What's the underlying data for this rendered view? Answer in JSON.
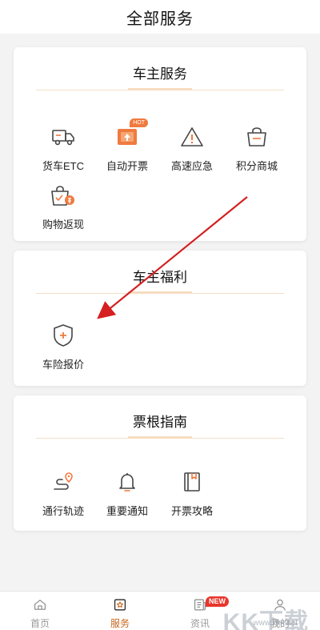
{
  "header": {
    "title": "全部服务"
  },
  "sections": [
    {
      "title": "车主服务",
      "items": [
        {
          "label": "货车ETC",
          "icon": "truck-icon"
        },
        {
          "label": "自动开票",
          "icon": "invoice-icon",
          "badge": "HOT"
        },
        {
          "label": "高速应急",
          "icon": "warning-icon"
        },
        {
          "label": "积分商城",
          "icon": "shop-bag-icon"
        },
        {
          "label": "购物返现",
          "icon": "cashback-bag-icon"
        }
      ]
    },
    {
      "title": "车主福利",
      "items": [
        {
          "label": "车险报价",
          "icon": "shield-plus-icon"
        }
      ]
    },
    {
      "title": "票根指南",
      "items": [
        {
          "label": "通行轨迹",
          "icon": "route-icon"
        },
        {
          "label": "重要通知",
          "icon": "bell-icon"
        },
        {
          "label": "开票攻略",
          "icon": "guide-book-icon"
        }
      ]
    }
  ],
  "tabbar": {
    "tabs": [
      {
        "label": "首页",
        "icon": "home-icon",
        "active": false
      },
      {
        "label": "服务",
        "icon": "service-icon",
        "active": true
      },
      {
        "label": "资讯",
        "icon": "news-icon",
        "active": false,
        "badge": "NEW"
      },
      {
        "label": "我的",
        "icon": "profile-icon",
        "active": false
      }
    ]
  },
  "watermark": {
    "text": "KK下载",
    "url": "www.kkx.net"
  },
  "colors": {
    "accent": "#c9651e",
    "icon_orange": "#ef7a3f",
    "icon_gray": "#444444",
    "arrow": "#d42020"
  }
}
